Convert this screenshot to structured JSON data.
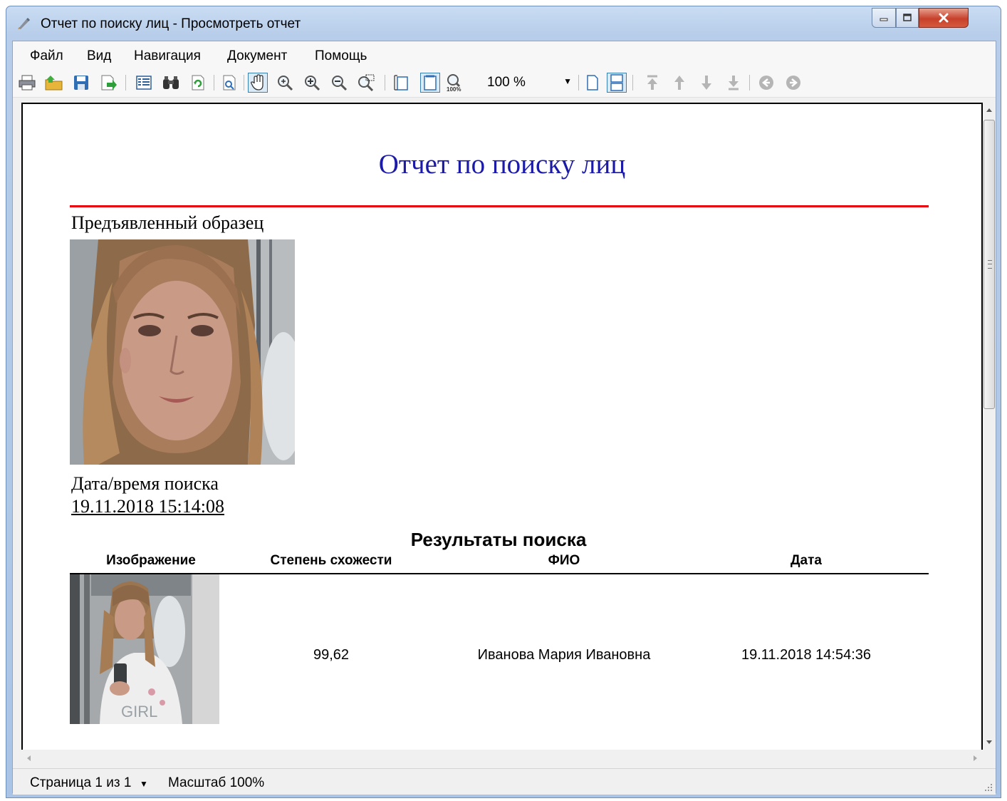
{
  "window": {
    "title": "Отчет по поиску лиц - Просмотреть отчет"
  },
  "menu": [
    "Файл",
    "Вид",
    "Навигация",
    "Документ",
    "Помощь"
  ],
  "toolbar": {
    "zoom_value": "100 %",
    "icons": [
      "print-icon",
      "open-icon",
      "save-icon",
      "export-icon",
      "thumbnails-icon",
      "find-icon",
      "refresh-icon",
      "page-setup-icon",
      "hand-tool-icon",
      "zoom-tool-icon",
      "zoom-in-icon",
      "zoom-out-icon",
      "zoom-area-icon",
      "page-width-icon",
      "whole-page-icon",
      "actual-size-icon",
      "single-page-icon",
      "continuous-page-icon",
      "first-page-icon",
      "previous-page-icon",
      "next-page-icon",
      "last-page-icon",
      "back-icon",
      "forward-icon"
    ]
  },
  "report": {
    "title": "Отчет по поиску лиц",
    "sample_label": "Предъявленный образец",
    "search_datetime_label": "Дата/время поиска",
    "search_datetime_value": "19.11.2018 15:14:08",
    "results_title": "Результаты поиска",
    "columns": [
      "Изображение",
      "Степень схожести",
      "ФИО",
      "Дата"
    ],
    "rows": [
      {
        "similarity": "99,62",
        "name": "Иванова Мария Ивановна",
        "date": "19.11.2018 14:54:36"
      }
    ]
  },
  "status": {
    "page": "Страница 1 из 1",
    "scale": "Масштаб 100%"
  },
  "colors": {
    "title_text": "#1b1ba8",
    "divider_red": "#e8000b",
    "window_frame": "#a9c4e6",
    "close_button": "#c7402a"
  }
}
